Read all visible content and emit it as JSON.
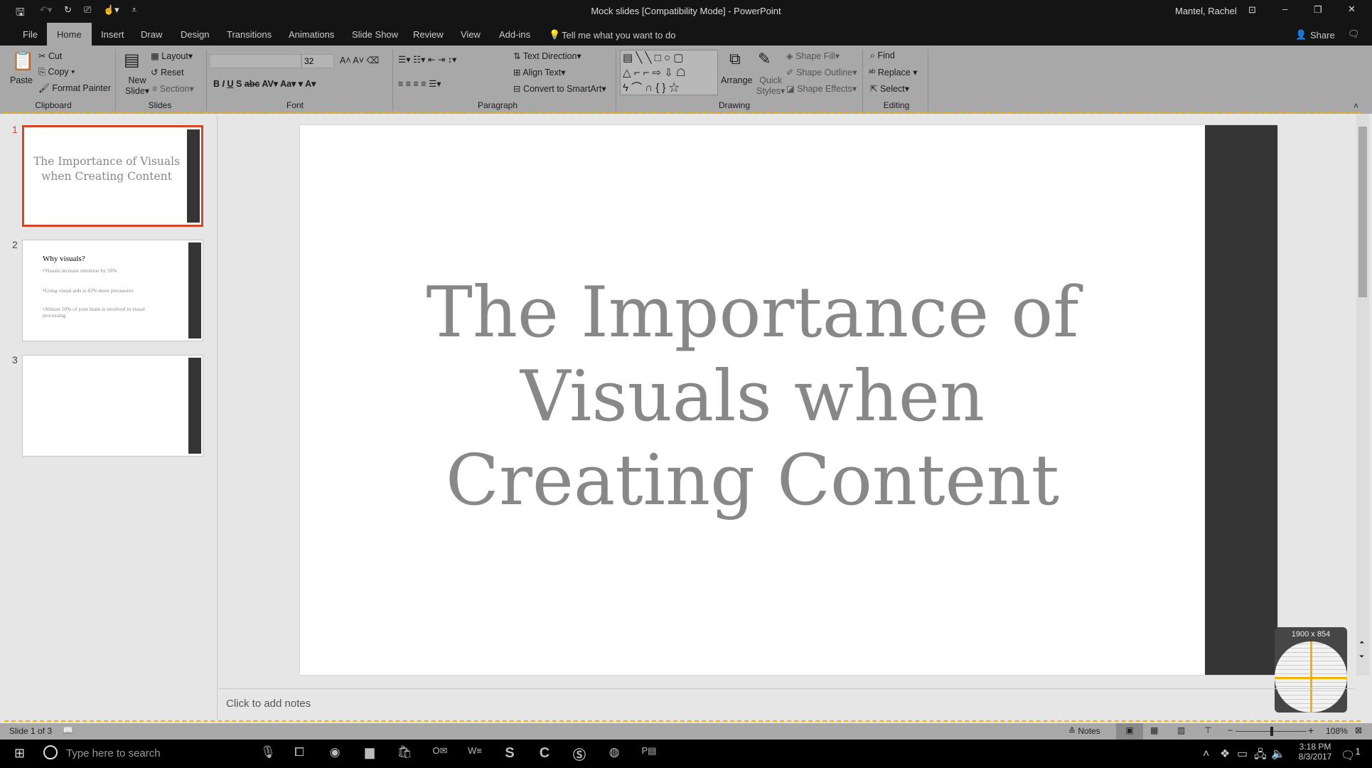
{
  "window": {
    "title": "Mock slides [Compatibility Mode]  -  PowerPoint",
    "user": "Mantel, Rachel"
  },
  "tabs": [
    "File",
    "Home",
    "Insert",
    "Draw",
    "Design",
    "Transitions",
    "Animations",
    "Slide Show",
    "Review",
    "View",
    "Add-ins"
  ],
  "tell_me": "Tell me what you want to do",
  "share": "Share",
  "ribbon": {
    "clipboard": {
      "paste": "Paste",
      "cut": "Cut",
      "copy": "Copy",
      "format_painter": "Format Painter",
      "label": "Clipboard"
    },
    "slides": {
      "new_slide": "New",
      "new_slide2": "Slide",
      "layout": "Layout",
      "reset": "Reset",
      "section": "Section",
      "label": "Slides"
    },
    "font": {
      "font_name": "",
      "font_size": "32",
      "label": "Font"
    },
    "paragraph": {
      "text_direction": "Text Direction",
      "align_text": "Align Text",
      "convert": "Convert to SmartArt",
      "label": "Paragraph"
    },
    "drawing": {
      "arrange": "Arrange",
      "quick": "Quick",
      "styles": "Styles",
      "fill": "Shape Fill",
      "outline": "Shape Outline",
      "effects": "Shape Effects",
      "label": "Drawing"
    },
    "editing": {
      "find": "Find",
      "replace": "Replace",
      "select": "Select",
      "label": "Editing"
    }
  },
  "thumbnails": [
    {
      "num": "1",
      "title": "The Importance of Visuals when Creating Content"
    },
    {
      "num": "2",
      "title": "Why visuals?",
      "bullets": [
        "Visuals increase retention by 50%",
        "Using visual aids is 43% more persuasive",
        "Almost 50% of your brain is involved in visual processing"
      ]
    },
    {
      "num": "3"
    }
  ],
  "slide": {
    "title_lines": [
      "The Importance of",
      "Visuals when",
      "Creating Content"
    ]
  },
  "notes_placeholder": "Click to add notes",
  "status": {
    "slide_count": "Slide 1 of 3",
    "notes": "Notes",
    "zoom": "108%",
    "zoom_level": 108
  },
  "magnifier": {
    "size": "1900 x 854"
  },
  "taskbar": {
    "search_placeholder": "Type here to search",
    "time": "3:18 PM",
    "date": "8/3/2017",
    "notifications": "1"
  },
  "colors": {
    "accent": "#d24726",
    "dash": "#f0b400"
  }
}
